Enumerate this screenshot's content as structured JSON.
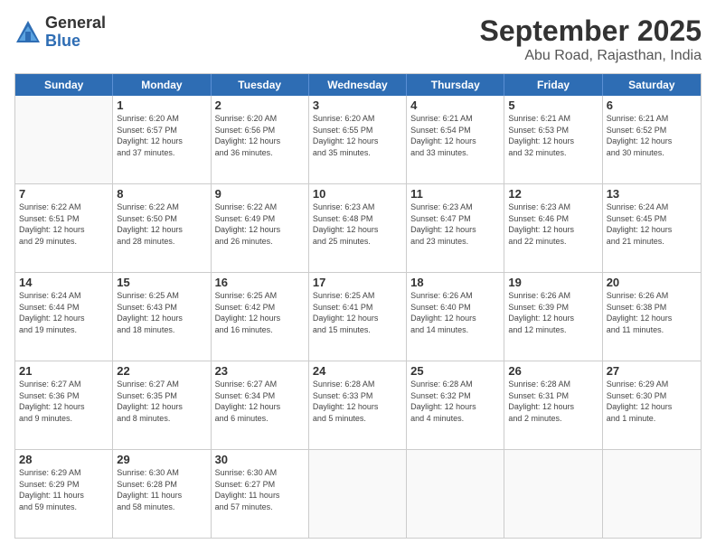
{
  "logo": {
    "general": "General",
    "blue": "Blue"
  },
  "title": "September 2025",
  "location": "Abu Road, Rajasthan, India",
  "weekdays": [
    "Sunday",
    "Monday",
    "Tuesday",
    "Wednesday",
    "Thursday",
    "Friday",
    "Saturday"
  ],
  "weeks": [
    [
      {
        "day": "",
        "info": ""
      },
      {
        "day": "1",
        "info": "Sunrise: 6:20 AM\nSunset: 6:57 PM\nDaylight: 12 hours\nand 37 minutes."
      },
      {
        "day": "2",
        "info": "Sunrise: 6:20 AM\nSunset: 6:56 PM\nDaylight: 12 hours\nand 36 minutes."
      },
      {
        "day": "3",
        "info": "Sunrise: 6:20 AM\nSunset: 6:55 PM\nDaylight: 12 hours\nand 35 minutes."
      },
      {
        "day": "4",
        "info": "Sunrise: 6:21 AM\nSunset: 6:54 PM\nDaylight: 12 hours\nand 33 minutes."
      },
      {
        "day": "5",
        "info": "Sunrise: 6:21 AM\nSunset: 6:53 PM\nDaylight: 12 hours\nand 32 minutes."
      },
      {
        "day": "6",
        "info": "Sunrise: 6:21 AM\nSunset: 6:52 PM\nDaylight: 12 hours\nand 30 minutes."
      }
    ],
    [
      {
        "day": "7",
        "info": "Sunrise: 6:22 AM\nSunset: 6:51 PM\nDaylight: 12 hours\nand 29 minutes."
      },
      {
        "day": "8",
        "info": "Sunrise: 6:22 AM\nSunset: 6:50 PM\nDaylight: 12 hours\nand 28 minutes."
      },
      {
        "day": "9",
        "info": "Sunrise: 6:22 AM\nSunset: 6:49 PM\nDaylight: 12 hours\nand 26 minutes."
      },
      {
        "day": "10",
        "info": "Sunrise: 6:23 AM\nSunset: 6:48 PM\nDaylight: 12 hours\nand 25 minutes."
      },
      {
        "day": "11",
        "info": "Sunrise: 6:23 AM\nSunset: 6:47 PM\nDaylight: 12 hours\nand 23 minutes."
      },
      {
        "day": "12",
        "info": "Sunrise: 6:23 AM\nSunset: 6:46 PM\nDaylight: 12 hours\nand 22 minutes."
      },
      {
        "day": "13",
        "info": "Sunrise: 6:24 AM\nSunset: 6:45 PM\nDaylight: 12 hours\nand 21 minutes."
      }
    ],
    [
      {
        "day": "14",
        "info": "Sunrise: 6:24 AM\nSunset: 6:44 PM\nDaylight: 12 hours\nand 19 minutes."
      },
      {
        "day": "15",
        "info": "Sunrise: 6:25 AM\nSunset: 6:43 PM\nDaylight: 12 hours\nand 18 minutes."
      },
      {
        "day": "16",
        "info": "Sunrise: 6:25 AM\nSunset: 6:42 PM\nDaylight: 12 hours\nand 16 minutes."
      },
      {
        "day": "17",
        "info": "Sunrise: 6:25 AM\nSunset: 6:41 PM\nDaylight: 12 hours\nand 15 minutes."
      },
      {
        "day": "18",
        "info": "Sunrise: 6:26 AM\nSunset: 6:40 PM\nDaylight: 12 hours\nand 14 minutes."
      },
      {
        "day": "19",
        "info": "Sunrise: 6:26 AM\nSunset: 6:39 PM\nDaylight: 12 hours\nand 12 minutes."
      },
      {
        "day": "20",
        "info": "Sunrise: 6:26 AM\nSunset: 6:38 PM\nDaylight: 12 hours\nand 11 minutes."
      }
    ],
    [
      {
        "day": "21",
        "info": "Sunrise: 6:27 AM\nSunset: 6:36 PM\nDaylight: 12 hours\nand 9 minutes."
      },
      {
        "day": "22",
        "info": "Sunrise: 6:27 AM\nSunset: 6:35 PM\nDaylight: 12 hours\nand 8 minutes."
      },
      {
        "day": "23",
        "info": "Sunrise: 6:27 AM\nSunset: 6:34 PM\nDaylight: 12 hours\nand 6 minutes."
      },
      {
        "day": "24",
        "info": "Sunrise: 6:28 AM\nSunset: 6:33 PM\nDaylight: 12 hours\nand 5 minutes."
      },
      {
        "day": "25",
        "info": "Sunrise: 6:28 AM\nSunset: 6:32 PM\nDaylight: 12 hours\nand 4 minutes."
      },
      {
        "day": "26",
        "info": "Sunrise: 6:28 AM\nSunset: 6:31 PM\nDaylight: 12 hours\nand 2 minutes."
      },
      {
        "day": "27",
        "info": "Sunrise: 6:29 AM\nSunset: 6:30 PM\nDaylight: 12 hours\nand 1 minute."
      }
    ],
    [
      {
        "day": "28",
        "info": "Sunrise: 6:29 AM\nSunset: 6:29 PM\nDaylight: 11 hours\nand 59 minutes."
      },
      {
        "day": "29",
        "info": "Sunrise: 6:30 AM\nSunset: 6:28 PM\nDaylight: 11 hours\nand 58 minutes."
      },
      {
        "day": "30",
        "info": "Sunrise: 6:30 AM\nSunset: 6:27 PM\nDaylight: 11 hours\nand 57 minutes."
      },
      {
        "day": "",
        "info": ""
      },
      {
        "day": "",
        "info": ""
      },
      {
        "day": "",
        "info": ""
      },
      {
        "day": "",
        "info": ""
      }
    ]
  ]
}
